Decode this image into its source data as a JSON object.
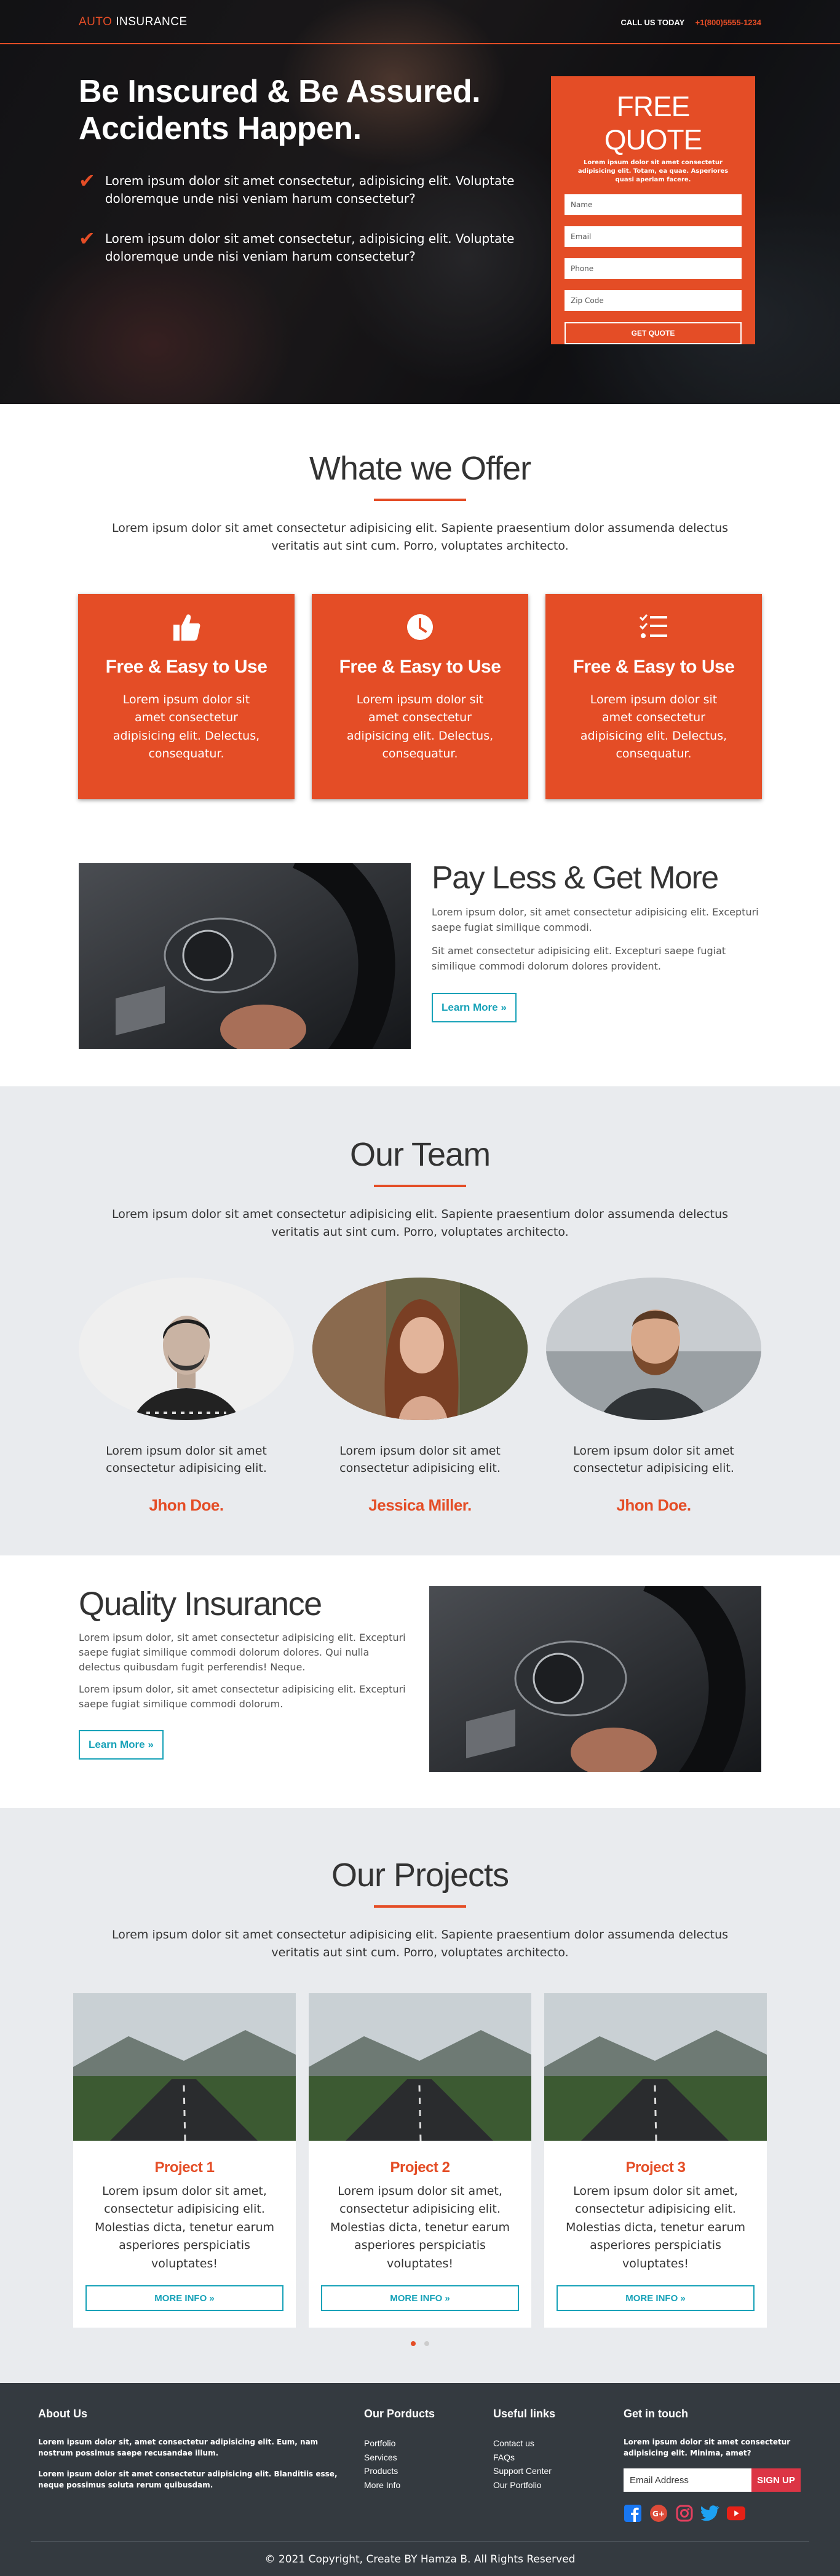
{
  "header": {
    "brand_part1": "AUTO",
    "brand_part2": " INSURANCE",
    "call_label": "CALL US TODAY",
    "phone": "+1(800)5555-1234"
  },
  "hero": {
    "title_line1": "Be Inscured & Be Assured.",
    "title_line2": "Accidents Happen.",
    "bullets": [
      "Lorem ipsum dolor sit amet consectetur, adipisicing elit. Voluptate doloremque unde nisi veniam harum consectetur?",
      "Lorem ipsum dolor sit amet consectetur, adipisicing elit. Voluptate doloremque unde nisi veniam harum consectetur?"
    ]
  },
  "quote_form": {
    "title": "FREE QUOTE",
    "subtitle": "Lorem ipsum dolor sit amet consectetur adipisicing elit. Totam, ea quae. Asperiores quasi aperiam facere.",
    "name_placeholder": "Name",
    "email_placeholder": "Email",
    "phone_placeholder": "Phone",
    "zip_placeholder": "Zip Code",
    "submit_label": "GET QUOTE"
  },
  "offer": {
    "title": "Whate we Offer",
    "description": "Lorem ipsum dolor sit amet consectetur adipisicing elit. Sapiente praesentium dolor assumenda delectus veritatis aut sint cum. Porro, voluptates architecto.",
    "cards": [
      {
        "icon": "thumbs-up-icon",
        "title": "Free & Easy to Use",
        "text": "Lorem ipsum dolor sit amet consectetur adipisicing elit. Delectus, consequatur."
      },
      {
        "icon": "clock-icon",
        "title": "Free & Easy to Use",
        "text": "Lorem ipsum dolor sit amet consectetur adipisicing elit. Delectus, consequatur."
      },
      {
        "icon": "checklist-icon",
        "title": "Free & Easy to Use",
        "text": "Lorem ipsum dolor sit amet consectetur adipisicing elit. Delectus, consequatur."
      }
    ]
  },
  "pay_less": {
    "title": "Pay Less & Get More",
    "para1": "Lorem ipsum dolor, sit amet consectetur adipisicing elit. Excepturi saepe fugiat similique commodi.",
    "para2": "Sit amet consectetur adipisicing elit. Excepturi saepe fugiat similique commodi dolorum dolores provident.",
    "button_label": "Learn More »"
  },
  "team": {
    "title": "Our Team",
    "description": "Lorem ipsum dolor sit amet consectetur adipisicing elit. Sapiente praesentium dolor assumenda delectus veritatis aut sint cum. Porro, voluptates architecto.",
    "members": [
      {
        "bio": "Lorem ipsum dolor sit amet consectetur adipisicing elit.",
        "name": "Jhon Doe."
      },
      {
        "bio": "Lorem ipsum dolor sit amet consectetur adipisicing elit.",
        "name": "Jessica Miller."
      },
      {
        "bio": "Lorem ipsum dolor sit amet consectetur adipisicing elit.",
        "name": "Jhon Doe."
      }
    ]
  },
  "quality": {
    "title": "Quality Insurance",
    "para1": "Lorem ipsum dolor, sit amet consectetur adipisicing elit. Excepturi saepe fugiat similique commodi dolorum dolores. Qui nulla delectus quibusdam fugit perferendis! Neque.",
    "para2": "Lorem ipsum dolor, sit amet consectetur adipisicing elit. Excepturi saepe fugiat similique commodi dolorum.",
    "button_label": "Learn More »"
  },
  "projects": {
    "title": "Our Projects",
    "description": "Lorem ipsum dolor sit amet consectetur adipisicing elit. Sapiente praesentium dolor assumenda delectus veritatis aut sint cum. Porro, voluptates architecto.",
    "items": [
      {
        "title": "Project 1",
        "text": "Lorem ipsum dolor sit amet, consectetur adipisicing elit. Molestias dicta, tenetur earum asperiores perspiciatis voluptates!",
        "button_label": "MORE INFO »"
      },
      {
        "title": "Project 2",
        "text": "Lorem ipsum dolor sit amet, consectetur adipisicing elit. Molestias dicta, tenetur earum asperiores perspiciatis voluptates!",
        "button_label": "MORE INFO »"
      },
      {
        "title": "Project 3",
        "text": "Lorem ipsum dolor sit amet, consectetur adipisicing elit. Molestias dicta, tenetur earum asperiores perspiciatis voluptates!",
        "button_label": "MORE INFO »"
      }
    ]
  },
  "footer": {
    "about_title": "About Us",
    "about_p1": "Lorem ipsum dolor sit, amet consectetur adipisicing elit. Eum, nam nostrum possimus saepe recusandae illum.",
    "about_p2": "Lorem ipsum dolor sit amet consectetur adipisicing elit. Blanditiis esse, neque possimus soluta rerum quibusdam.",
    "products_title": "Our Porducts",
    "products": [
      "Portfolio",
      "Services",
      "Products",
      "More Info"
    ],
    "links_title": "Useful links",
    "links": [
      "Contact us",
      "FAQs",
      "Support Center",
      "Our Portfolio"
    ],
    "touch_title": "Get in touch",
    "touch_text": "Lorem ipsum dolor sit amet consectetur adipisicing elit. Minima, amet?",
    "email_placeholder": "Email Address",
    "signup_label": "SIGN UP",
    "socials": [
      {
        "icon": "facebook-icon",
        "color": "#1877f2"
      },
      {
        "icon": "google-plus-icon",
        "color": "#dd4b39"
      },
      {
        "icon": "instagram-icon",
        "color": "#e4405f"
      },
      {
        "icon": "twitter-icon",
        "color": "#1da1f2"
      },
      {
        "icon": "youtube-icon",
        "color": "#e62117"
      }
    ],
    "copyright": "© 2021 Copyright, Create BY Hamza B. All Rights Reserved"
  },
  "colors": {
    "accent": "#e44d26",
    "button_outline": "#17a2b8",
    "footer_bg": "#343a40",
    "section_gray": "#e9ebee"
  }
}
